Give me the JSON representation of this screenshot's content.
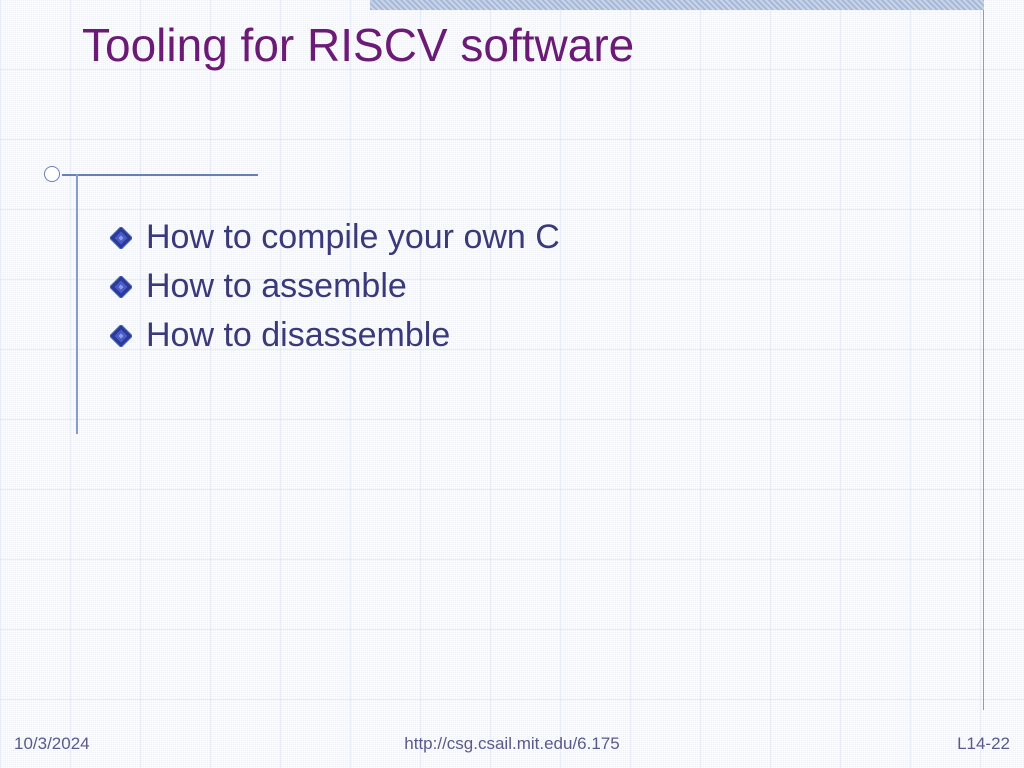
{
  "title": "Tooling for RISCV software",
  "bullets": [
    "How to compile your own C",
    "How to assemble",
    "How to disassemble"
  ],
  "footer": {
    "date": "10/3/2024",
    "url": "http://csg.csail.mit.edu/6.175",
    "page": "L14-22"
  }
}
